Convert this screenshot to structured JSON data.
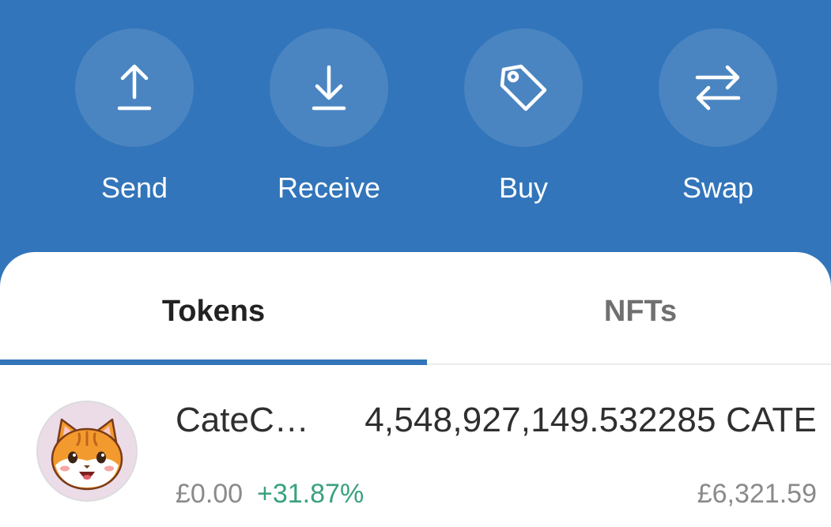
{
  "actions": {
    "send": {
      "label": "Send",
      "icon": "upload-arrow-icon"
    },
    "receive": {
      "label": "Receive",
      "icon": "download-arrow-icon"
    },
    "buy": {
      "label": "Buy",
      "icon": "price-tag-icon"
    },
    "swap": {
      "label": "Swap",
      "icon": "swap-arrows-icon"
    }
  },
  "tabs": {
    "tokens": "Tokens",
    "nfts": "NFTs",
    "active": "tokens"
  },
  "token": {
    "name": "CateC…",
    "amount": "4,548,927,149.532285 CATE",
    "price": "£0.00",
    "change": "+31.87%",
    "fiat_value": "£6,321.59",
    "icon": "cat-face-logo-icon"
  },
  "colors": {
    "brand_blue": "#3275ba",
    "positive_green": "#3aa17e",
    "muted_text": "#8a8a8a"
  }
}
